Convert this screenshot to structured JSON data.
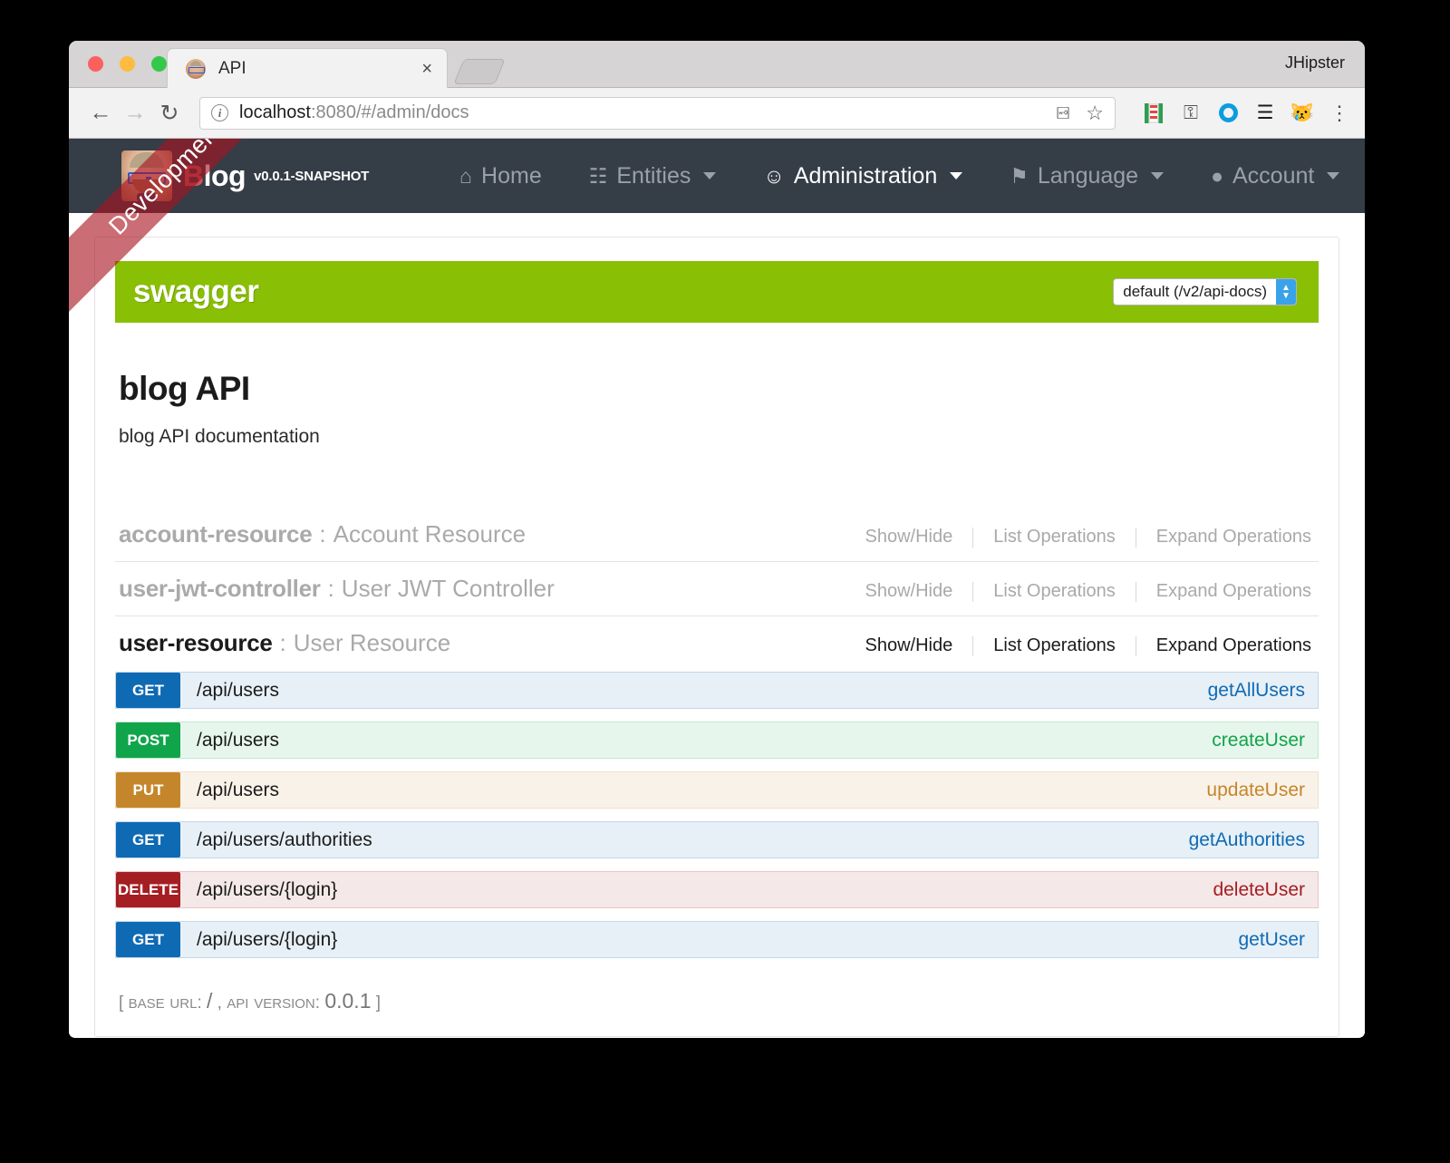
{
  "browser": {
    "tab_title": "API",
    "tab_favicon": "jhipster-avatar-icon",
    "close_label": "×",
    "window_user": "JHipster",
    "back_label": "←",
    "forward_label": "→",
    "reload_label": "↻",
    "url_host": "localhost",
    "url_path": ":8080/#/admin/docs",
    "key_icon": "⚿",
    "star_icon": "☆",
    "menu_icon": "⋮",
    "extensions": [
      "lighthouse-icon",
      "privacy-shield-icon",
      "circle-o-icon",
      "layers-icon",
      "cat-icon"
    ]
  },
  "ribbon": {
    "label": "Development"
  },
  "navbar": {
    "brand_prefix": "B",
    "brand_suffix": "log",
    "version": "v0.0.1-SNAPSHOT",
    "items": [
      {
        "label": "Home",
        "icon": "⌂",
        "icon_name": "home-icon",
        "caret": false,
        "active": false
      },
      {
        "label": "Entities",
        "icon": "☷",
        "icon_name": "list-icon",
        "caret": true,
        "active": false
      },
      {
        "label": "Administration",
        "icon": "☺",
        "icon_name": "user-plus-icon",
        "caret": true,
        "active": true
      },
      {
        "label": "Language",
        "icon": "⚑",
        "icon_name": "flag-icon",
        "caret": true,
        "active": false
      },
      {
        "label": "Account",
        "icon": "●",
        "icon_name": "user-icon",
        "caret": true,
        "active": false
      }
    ]
  },
  "swagger": {
    "logo": "swagger",
    "selected_spec": "default (/v2/api-docs)"
  },
  "api": {
    "title": "blog API",
    "description": "blog API documentation",
    "base_url_label": "base url",
    "base_url_value": "/",
    "api_version_label": "api version",
    "api_version_value": "0.0.1",
    "footer_open": "[",
    "footer_close": "]",
    "footer_comma": ","
  },
  "actions": {
    "show_hide": "Show/Hide",
    "list_operations": "List Operations",
    "expand_operations": "Expand Operations"
  },
  "resources": [
    {
      "name": "account-resource",
      "separator": ":",
      "description": "Account Resource",
      "active": false
    },
    {
      "name": "user-jwt-controller",
      "separator": ":",
      "description": "User JWT Controller",
      "active": false
    },
    {
      "name": "user-resource",
      "separator": ":",
      "description": "User Resource",
      "active": true
    }
  ],
  "operations": [
    {
      "method": "GET",
      "kind": "get",
      "path": "/api/users",
      "nickname": "getAllUsers"
    },
    {
      "method": "POST",
      "kind": "post",
      "path": "/api/users",
      "nickname": "createUser"
    },
    {
      "method": "PUT",
      "kind": "put",
      "path": "/api/users",
      "nickname": "updateUser"
    },
    {
      "method": "GET",
      "kind": "get",
      "path": "/api/users/authorities",
      "nickname": "getAuthorities"
    },
    {
      "method": "DELETE",
      "kind": "delete",
      "path": "/api/users/{login}",
      "nickname": "deleteUser"
    },
    {
      "method": "GET",
      "kind": "get",
      "path": "/api/users/{login}",
      "nickname": "getUser"
    }
  ],
  "colors": {
    "navbar_bg": "#353d47",
    "swagger_green": "#89bf04",
    "get": "#0f6ab4",
    "post": "#10a54a",
    "put": "#c5862b",
    "delete": "#a41e22",
    "brand_red": "#c9575b",
    "ribbon": "#aa1420"
  }
}
